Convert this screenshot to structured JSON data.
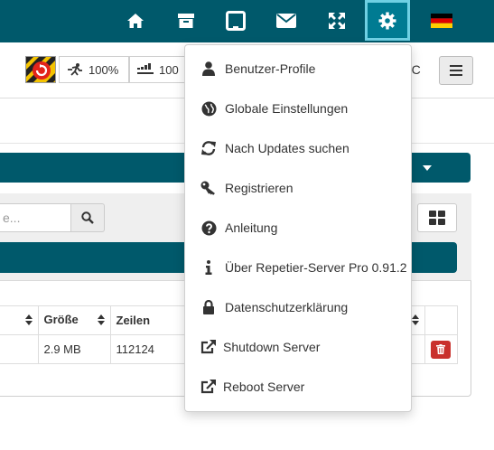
{
  "colors": {
    "navbar": "#00596b",
    "active_nav": "#007b92",
    "danger": "#c9302c"
  },
  "navbar": {
    "icons": [
      "home-icon",
      "archive-icon",
      "tablet-icon",
      "envelope-icon",
      "expand-icon",
      "gear-icon",
      "german-flag-icon"
    ]
  },
  "status": {
    "speed": "100%",
    "flow": "100",
    "temp_unit": "°C"
  },
  "search": {
    "placeholder": "e..."
  },
  "table": {
    "headers": [
      "Größe",
      "Zeilen"
    ],
    "rows": [
      {
        "size": "2.9 MB",
        "lines": "112124"
      }
    ]
  },
  "dropdown": {
    "items": [
      {
        "icon": "user-icon",
        "label": "Benutzer-Profile"
      },
      {
        "icon": "globe-icon",
        "label": "Globale Einstellungen"
      },
      {
        "icon": "refresh-icon",
        "label": "Nach Updates suchen"
      },
      {
        "icon": "key-icon",
        "label": "Registrieren"
      },
      {
        "icon": "question-circle-icon",
        "label": "Anleitung"
      },
      {
        "icon": "info-icon",
        "label": "Über Repetier-Server Pro 0.91.2"
      },
      {
        "icon": "lock-icon",
        "label": "Datenschutzerklärung"
      },
      {
        "icon": "external-link-icon",
        "label": "Shutdown Server"
      },
      {
        "icon": "external-link-icon",
        "label": "Reboot Server"
      }
    ]
  }
}
